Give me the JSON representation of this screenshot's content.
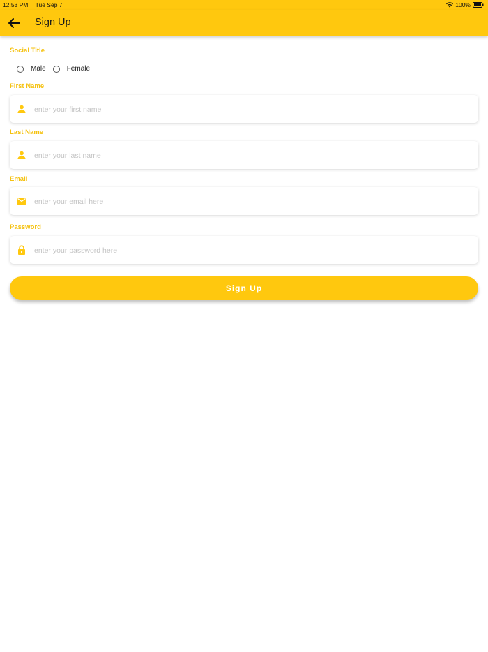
{
  "status_bar": {
    "time": "12:53 PM",
    "date": "Tue Sep 7",
    "battery": "100%"
  },
  "app_bar": {
    "title": "Sign Up",
    "back_icon": "arrow-left-icon"
  },
  "form": {
    "social_title": {
      "label": "Social Title",
      "options": [
        "Male",
        "Female"
      ]
    },
    "first_name": {
      "label": "First Name",
      "placeholder": "enter your first name",
      "icon": "person-icon"
    },
    "last_name": {
      "label": "Last Name",
      "placeholder": "enter your last name",
      "icon": "person-icon"
    },
    "email": {
      "label": "Email",
      "placeholder": "enter your email here",
      "icon": "mail-icon"
    },
    "password": {
      "label": "Password",
      "placeholder": "enter your password here",
      "icon": "lock-icon"
    },
    "submit_label": "Sign Up"
  },
  "colors": {
    "accent": "#ffc80e",
    "label": "#f5c211",
    "placeholder": "#c4c4c4"
  }
}
